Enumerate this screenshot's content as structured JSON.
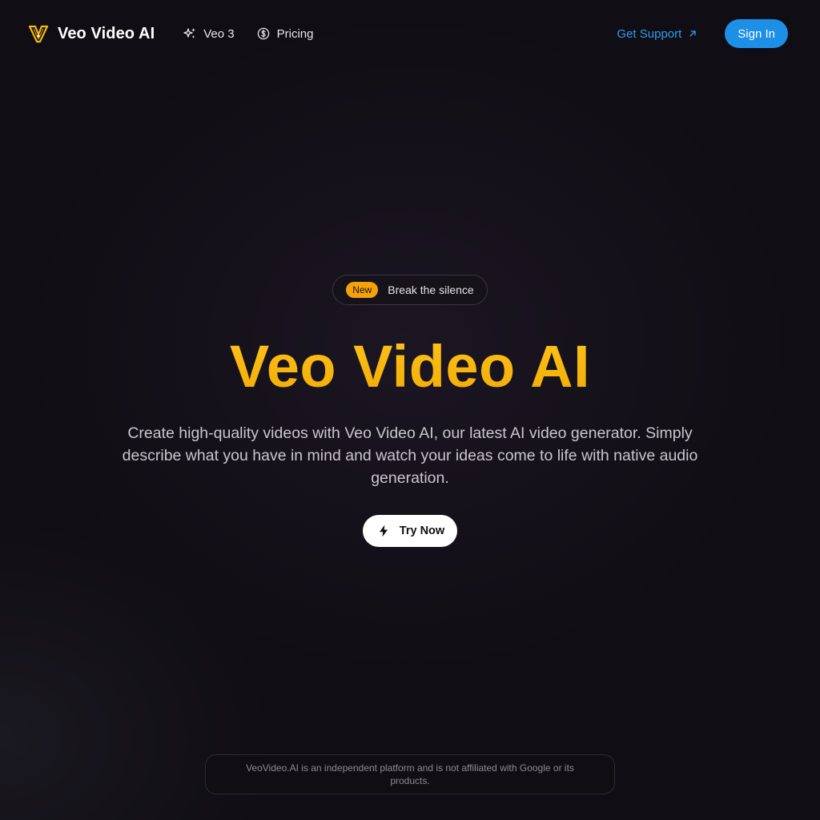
{
  "nav": {
    "brand_name": "Veo Video AI",
    "links": [
      {
        "label": "Veo 3",
        "icon": "sparkles-icon"
      },
      {
        "label": "Pricing",
        "icon": "dollar-circle-icon"
      }
    ],
    "support_label": "Get Support",
    "signin_label": "Sign In"
  },
  "hero": {
    "badge": "New",
    "announcement": "Break the silence",
    "title": "Veo Video AI",
    "description": "Create high-quality videos with Veo Video AI, our latest AI video generator. Simply describe what you have in mind and watch your ideas come to life with native audio generation.",
    "cta_label": "Try Now"
  },
  "footer": {
    "disclaimer": "VeoVideo.AI is an independent platform and is not affiliated with Google or its products."
  },
  "colors": {
    "accent_gold": "#f5b80c",
    "badge_orange": "#f4a10b",
    "link_blue": "#2f9df0",
    "signin_blue": "#1d8fe6",
    "background": "#100d14"
  }
}
